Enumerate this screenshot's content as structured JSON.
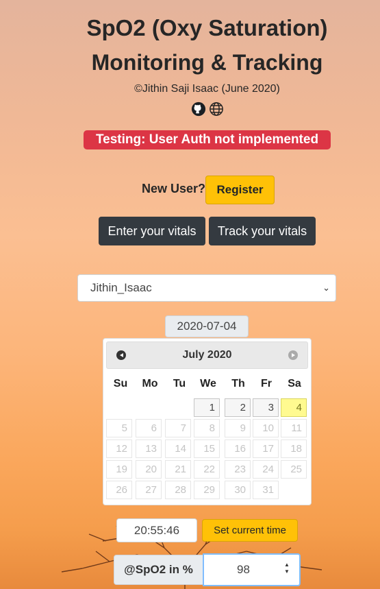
{
  "header": {
    "title_line1": "SpO2 (Oxy Saturation)",
    "title_line2": "Monitoring & Tracking",
    "credit": "©Jithin Saji Isaac (June 2020)"
  },
  "icons": [
    "github-icon",
    "globe-icon"
  ],
  "alert_badge": "Testing: User Auth not implemented",
  "register": {
    "prompt": "New User?",
    "button_label": "Register"
  },
  "actions": {
    "enter_label": "Enter your vitals",
    "track_label": "Track your vitals"
  },
  "user_select": {
    "selected": "Jithin_Isaac"
  },
  "date_input": {
    "value": "2020-07-04"
  },
  "calendar": {
    "month_label": "July 2020",
    "weekdays": [
      "Su",
      "Mo",
      "Tu",
      "We",
      "Th",
      "Fr",
      "Sa"
    ],
    "week1": [
      "1",
      "2",
      "3",
      "4"
    ],
    "week2": [
      "5",
      "6",
      "7",
      "8",
      "9",
      "10",
      "11"
    ],
    "week3": [
      "12",
      "13",
      "14",
      "15",
      "16",
      "17",
      "18"
    ],
    "week4": [
      "19",
      "20",
      "21",
      "22",
      "23",
      "24",
      "25"
    ],
    "week5": [
      "26",
      "27",
      "28",
      "29",
      "30",
      "31"
    ]
  },
  "time": {
    "value": "20:55:46",
    "button_label": "Set current time"
  },
  "spo2": {
    "label": "@SpO2 in %",
    "value": "98"
  },
  "colors": {
    "alert": "#dc3545",
    "warning": "#ffc107",
    "dark": "#343a40",
    "highlight": "#fffa90"
  }
}
